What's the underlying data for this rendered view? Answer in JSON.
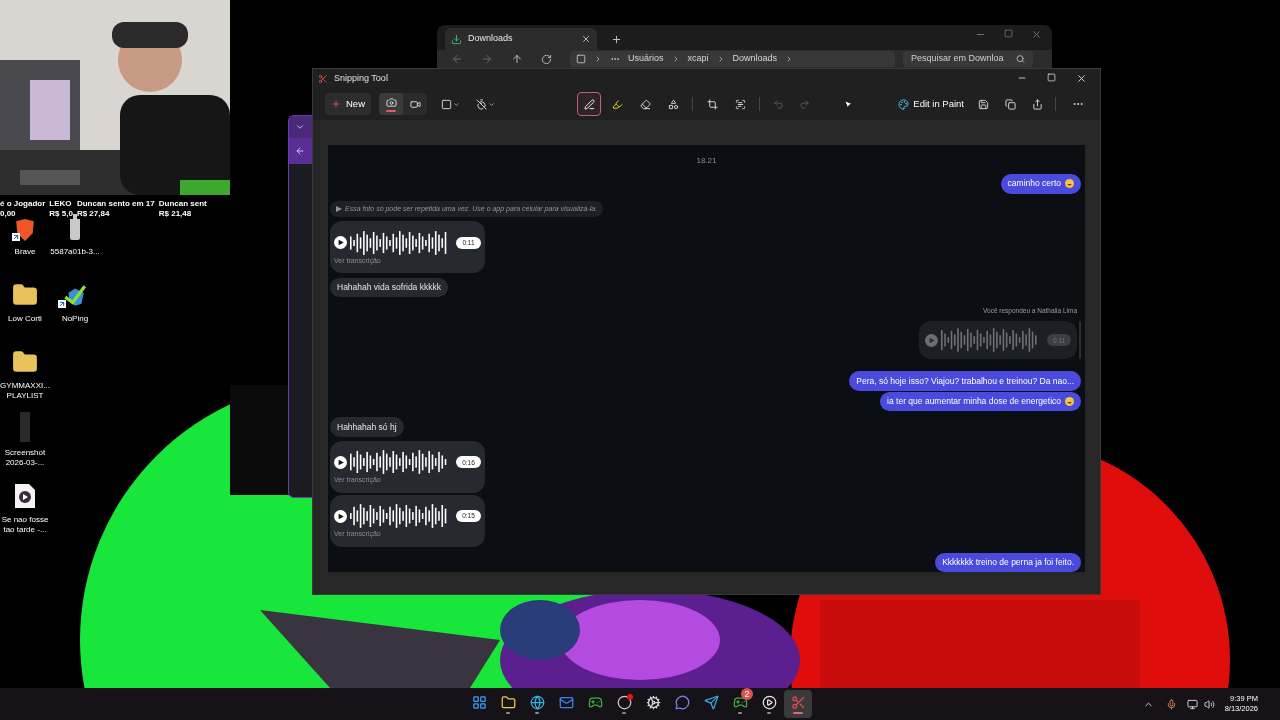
{
  "ticker": [
    {
      "name": "é o Jogador",
      "amount": "0,00"
    },
    {
      "name": "LEKO",
      "amount": "R$ 5,0"
    },
    {
      "name": "Duncan sento em 17",
      "amount": "R$ 27,84"
    },
    {
      "name": "Duncan sent",
      "amount": "R$ 21,48"
    }
  ],
  "desktop_icons": [
    {
      "label": "Brave",
      "shortcut": true
    },
    {
      "label": "5587a01b-3...",
      "shortcut": false
    },
    {
      "label": "Low Corti",
      "shortcut": false
    },
    {
      "label": "NoPing",
      "shortcut": true
    },
    {
      "label": "GYMMAXXI... PLAYLIST",
      "shortcut": false
    },
    {
      "label": "Screenshot 2026-03-...",
      "shortcut": false
    },
    {
      "label": "Se nao fosse tao tarde -...",
      "shortcut": false
    }
  ],
  "explorer": {
    "tab": "Downloads",
    "breadcrumb": [
      "Usuários",
      "xcapi",
      "Downloads"
    ],
    "search_placeholder": "Pesquisar em Downloa"
  },
  "snipping_tool": {
    "title": "Snipping Tool",
    "new_button": "New",
    "modes": [
      {
        "selected": true
      },
      {
        "selected": false
      }
    ],
    "tools": [
      {
        "selected": true
      },
      {
        "selected": false
      },
      {
        "selected": false
      },
      {
        "selected": false
      },
      {
        "selected": false
      },
      {
        "selected": false
      }
    ],
    "history": [
      {
        "disabled": true
      },
      {
        "disabled": true
      }
    ],
    "edit_in_paint": "Edit in Paint"
  },
  "chat": {
    "messages": [
      {
        "kind": "time",
        "text": "18.21"
      },
      {
        "kind": "text",
        "outgoing": true,
        "text": "caminho certo",
        "emoji": true
      },
      {
        "kind": "notice",
        "text": "Essa foto só pode ser repetida uma vez. Use o app para celular para visualizá-la."
      },
      {
        "kind": "voice",
        "duration": "0:11",
        "link": "Ver transcrição"
      },
      {
        "kind": "text",
        "outgoing": false,
        "text": "Hahahah vida sofrida kkkkk",
        "emoji": false
      },
      {
        "kind": "reply_label",
        "text": "Você respondeu a Nathalia Lima"
      },
      {
        "kind": "voice_reply",
        "duration": "0:11"
      },
      {
        "kind": "text",
        "outgoing": true,
        "text": "Pera, só hoje isso? Viajou? trabalhou e treinou? Da nao...",
        "emoji": false
      },
      {
        "kind": "text",
        "outgoing": true,
        "text": "ia ter que aumentar minha dose de energetico",
        "emoji": true
      },
      {
        "kind": "text",
        "outgoing": false,
        "text": "Hahhahah só hj",
        "emoji": false
      },
      {
        "kind": "voice",
        "duration": "0:16",
        "link": "Ver transcrição"
      },
      {
        "kind": "voice",
        "duration": "0:15",
        "link": "Ver transcrição"
      },
      {
        "kind": "text",
        "outgoing": true,
        "text": "Kkkkkkk treino de perna ja foi feito.",
        "emoji": false
      }
    ]
  },
  "taskbar": {
    "apps": [
      {
        "running": false,
        "active": false,
        "alert": false
      },
      {
        "running": true,
        "active": false,
        "alert": false
      },
      {
        "running": true,
        "active": false,
        "alert": false
      },
      {
        "running": false,
        "active": false,
        "alert": false
      },
      {
        "running": false,
        "active": false,
        "alert": false
      },
      {
        "running": true,
        "active": false,
        "alert": true
      },
      {
        "running": false,
        "active": false,
        "alert": false
      },
      {
        "running": false,
        "active": false,
        "alert": false
      },
      {
        "running": false,
        "active": false,
        "alert": false
      },
      {
        "running": true,
        "active": false,
        "alert": false,
        "badge": "2"
      },
      {
        "running": true,
        "active": false,
        "alert": false
      },
      {
        "running": true,
        "active": true,
        "alert": false
      }
    ],
    "time": "9:39 PM",
    "date": "8/13/2026"
  }
}
